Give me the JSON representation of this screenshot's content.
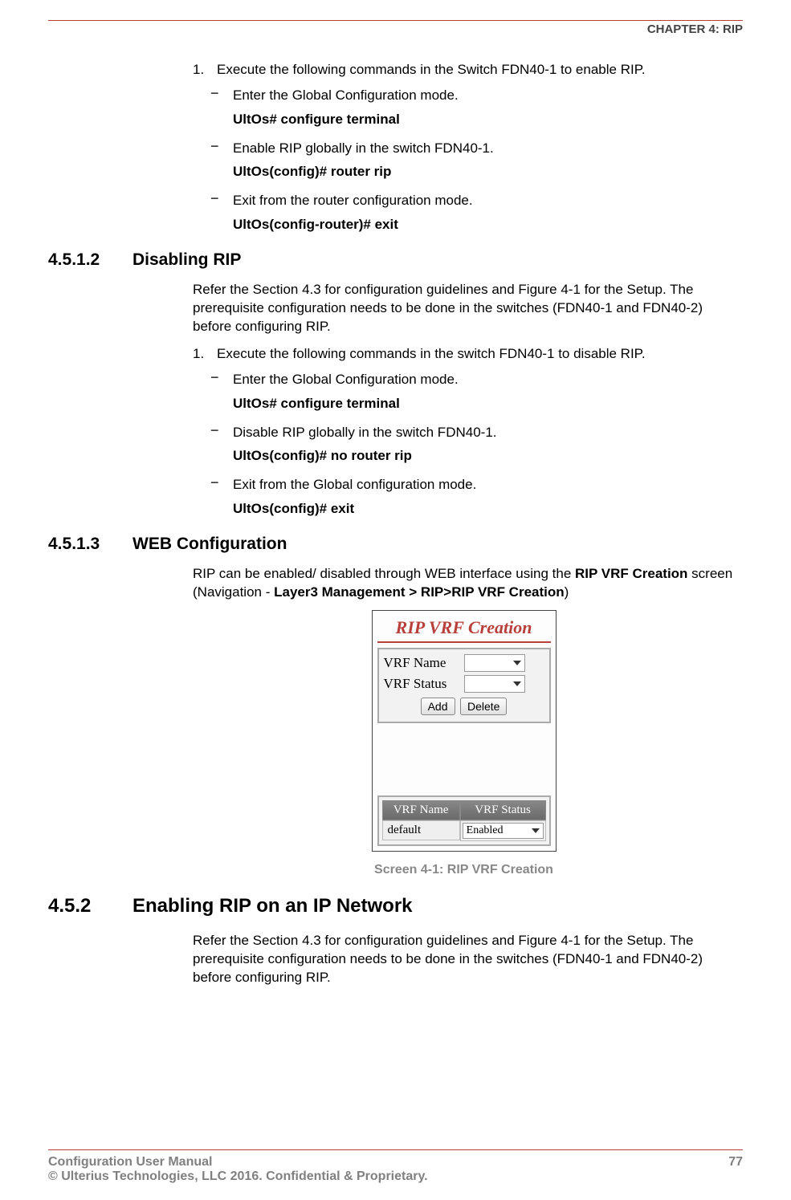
{
  "header": {
    "chapter": "CHAPTER 4: RIP"
  },
  "block1": {
    "step1": "Execute the following commands in the Switch FDN40-1 to enable RIP.",
    "sub1": "Enter the Global Configuration mode.",
    "cmd1": "UltOs# configure terminal",
    "sub2": "Enable RIP globally in the switch FDN40-1.",
    "cmd2": "UltOs(config)# router rip",
    "sub3": "Exit from the router configuration mode.",
    "cmd3": "UltOs(config-router)# exit"
  },
  "sec4512": {
    "num": "4.5.1.2",
    "title": "Disabling RIP",
    "para": "Refer the Section 4.3 for configuration guidelines and Figure 4-1 for the Setup. The prerequisite configuration needs to be done in the switches (FDN40-1 and FDN40-2) before configuring RIP.",
    "step1": "Execute the following commands in the switch FDN40-1 to disable RIP.",
    "sub1": "Enter the Global Configuration mode.",
    "cmd1": "UltOs# configure terminal",
    "sub2": "Disable RIP globally in the switch FDN40-1.",
    "cmd2": "UltOs(config)# no router rip",
    "sub3": "Exit from the Global configuration mode.",
    "cmd3": "UltOs(config)# exit"
  },
  "sec4513": {
    "num": "4.5.1.3",
    "title": "WEB Configuration",
    "para_pre": "RIP can be enabled/ disabled through WEB interface using the ",
    "para_b1": "RIP VRF Creation",
    "para_mid": " screen (Navigation - ",
    "para_b2": "Layer3 Management > RIP>RIP VRF Creation",
    "para_post": ")"
  },
  "screenshot": {
    "title": "RIP VRF Creation",
    "vrf_name_label": "VRF Name",
    "vrf_status_label": "VRF Status",
    "add_btn": "Add",
    "delete_btn": "Delete",
    "th_name": "VRF Name",
    "th_status": "VRF Status",
    "td_name": "default",
    "td_status": "Enabled",
    "caption": "Screen 4-1: RIP VRF Creation"
  },
  "sec452": {
    "num": "4.5.2",
    "title": "Enabling RIP on an IP Network",
    "para": "Refer the Section 4.3 for configuration guidelines and Figure 4-1 for the Setup. The prerequisite configuration needs to be done in the switches (FDN40-1 and FDN40-2) before configuring RIP."
  },
  "footer": {
    "left": "Configuration User Manual",
    "right": "77",
    "line2": "© Ulterius Technologies, LLC 2016. Confidential & Proprietary."
  }
}
